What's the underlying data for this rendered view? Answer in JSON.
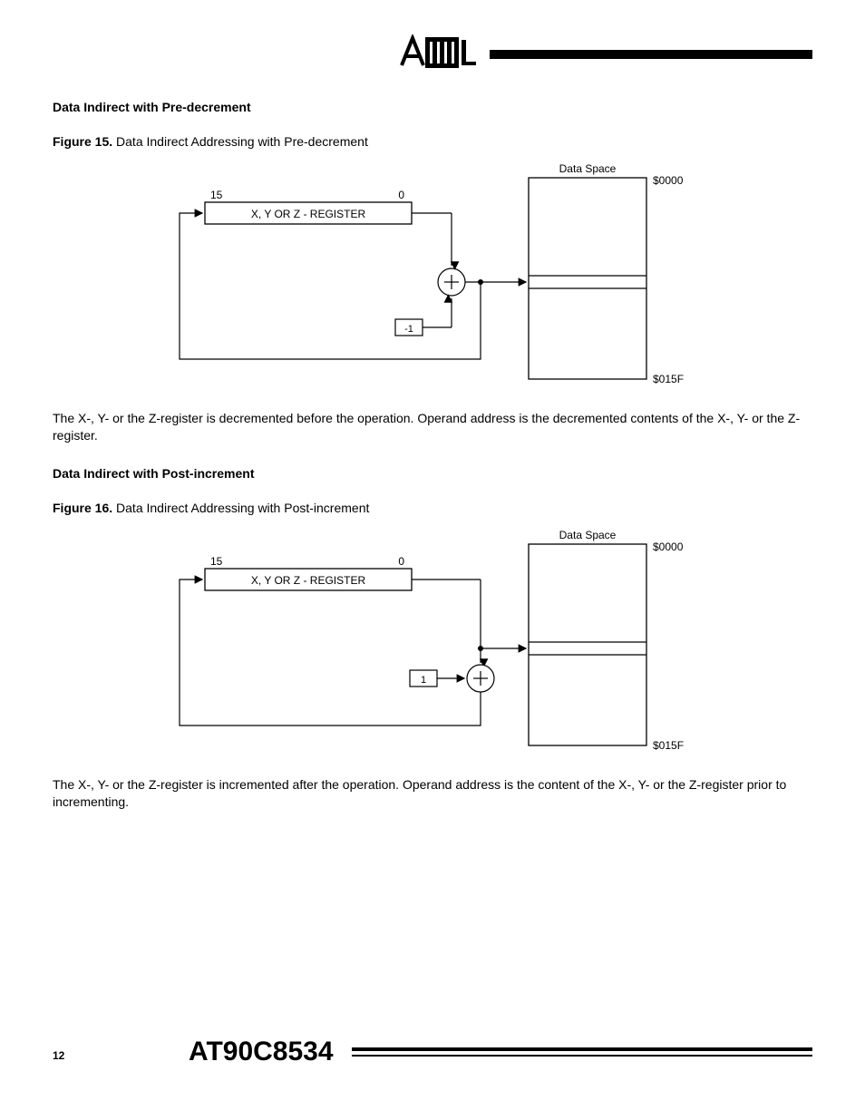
{
  "header": {
    "brand": "Atmel"
  },
  "section1": {
    "heading": "Data Indirect with Pre-decrement",
    "figure_label": "Figure 15.",
    "figure_title": "Data Indirect Addressing with Pre-decrement",
    "diagram": {
      "data_space_label": "Data Space",
      "addr_top": "$0000",
      "addr_bottom": "$015F",
      "bit_hi": "15",
      "bit_lo": "0",
      "register_label": "X, Y OR Z - REGISTER",
      "const_box": "-1"
    },
    "paragraph": "The X-, Y- or the Z-register is decremented before the operation. Operand address is the decremented contents of the X-, Y- or the Z-register."
  },
  "section2": {
    "heading": "Data Indirect with Post-increment",
    "figure_label": "Figure 16.",
    "figure_title": "Data Indirect Addressing with Post-increment",
    "diagram": {
      "data_space_label": "Data Space",
      "addr_top": "$0000",
      "addr_bottom": "$015F",
      "bit_hi": "15",
      "bit_lo": "0",
      "register_label": "X, Y OR Z - REGISTER",
      "const_box": "1"
    },
    "paragraph": "The X-, Y- or the Z-register is incremented after the operation. Operand address is the content of the X-, Y- or the Z-register prior to incrementing."
  },
  "footer": {
    "page_number": "12",
    "doc_title": "AT90C8534"
  }
}
